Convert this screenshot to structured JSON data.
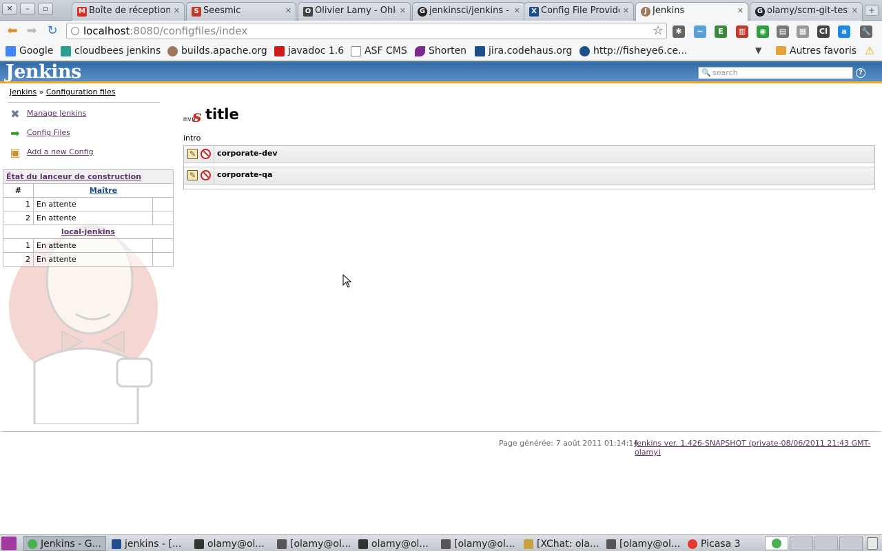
{
  "browser": {
    "tabs": [
      {
        "label": "Boîte de réception",
        "icon": "gmail-icon",
        "color": "#d93025",
        "glyph": "M"
      },
      {
        "label": "Seesmic",
        "icon": "seesmic-icon",
        "color": "#c0392b",
        "glyph": "S"
      },
      {
        "label": "Olivier Lamy - Ohlo",
        "icon": "ohloh-icon",
        "color": "#444444",
        "glyph": "O"
      },
      {
        "label": "jenkinsci/jenkins - G",
        "icon": "github-icon",
        "color": "#222222",
        "glyph": "G"
      },
      {
        "label": "Config File Provider",
        "icon": "confluence-icon",
        "color": "#1f4e8c",
        "glyph": "X"
      },
      {
        "label": "Jenkins",
        "icon": "jenkins-icon",
        "color": "#a0765a",
        "glyph": "J"
      },
      {
        "label": "olamy/scm-git-test",
        "icon": "github-icon",
        "color": "#222222",
        "glyph": "G"
      }
    ],
    "url_host": "localhost",
    "url_path": ":8080/configfiles/index",
    "bookmarks": [
      {
        "label": "Google",
        "icon": "google-icon",
        "color": "#4285f4"
      },
      {
        "label": "cloudbees jenkins",
        "icon": "cloudbees-icon",
        "color": "#2a9d8f"
      },
      {
        "label": "builds.apache.org",
        "icon": "jenkins-icon",
        "color": "#a0765a"
      },
      {
        "label": "javadoc 1.6",
        "icon": "oracle-icon",
        "color": "#d01c1c"
      },
      {
        "label": "ASF CMS",
        "icon": "page-icon",
        "color": "#dddddd"
      },
      {
        "label": "Shorten",
        "icon": "feather-icon",
        "color": "#7b2d8e"
      },
      {
        "label": "jira.codehaus.org",
        "icon": "jira-icon",
        "color": "#1f4e8c"
      },
      {
        "label": "http://fisheye6.ce...",
        "icon": "fisheye-icon",
        "color": "#1f4e8c"
      }
    ],
    "other_bookmarks": "Autres favoris"
  },
  "jenkins": {
    "logo": "Jenkins",
    "search_placeholder": "search",
    "help": "?",
    "breadcrumb": {
      "home": "Jenkins",
      "sep": "»",
      "current": "Configuration files"
    },
    "tasks": [
      {
        "label": "Manage Jenkins",
        "icon": "wrench-screwdriver-icon"
      },
      {
        "label": "Config Files",
        "icon": "green-arrow-icon"
      },
      {
        "label": "Add a new Config",
        "icon": "package-box-icon"
      }
    ],
    "executors": {
      "caption": "État du lanceur de construction",
      "hash_header": "#",
      "master_label": "Maître",
      "master_rows": [
        {
          "num": "1",
          "status": "En attente"
        },
        {
          "num": "2",
          "status": "En attente"
        }
      ],
      "node_label": "local-jenkins",
      "node_rows": [
        {
          "num": "1",
          "status": "En attente"
        },
        {
          "num": "2",
          "status": "En attente"
        }
      ]
    },
    "main": {
      "logo_text": "mvn",
      "logo_glyph": "s",
      "title": "title",
      "intro": "intro",
      "configs": [
        {
          "name": "corporate-dev"
        },
        {
          "name": "corporate-qa"
        }
      ]
    },
    "footer": {
      "generated": "Page générée: 7 août 2011 01:14:14",
      "version": "Jenkins ver. 1.426-SNAPSHOT (private-08/06/2011 21:43 GMT-olamy)"
    },
    "colors": {
      "header": "#2e6aa8",
      "accent": "#f5a623",
      "link": "#5c3566"
    }
  },
  "taskbar": {
    "items": [
      {
        "label": "Jenkins - G...",
        "icon": "chrome-icon",
        "color": "#4caf50",
        "active": true
      },
      {
        "label": "jenkins - [...",
        "icon": "intellij-icon",
        "color": "#1f4e8c",
        "active": false
      },
      {
        "label": "olamy@ol...",
        "icon": "terminal-icon",
        "color": "#333333",
        "active": false
      },
      {
        "label": "[olamy@ol...",
        "icon": "terminal-icon",
        "color": "#555555",
        "active": false
      },
      {
        "label": "olamy@ol...",
        "icon": "terminal-icon",
        "color": "#333333",
        "active": false
      },
      {
        "label": "[olamy@ol...",
        "icon": "terminal-icon",
        "color": "#555555",
        "active": false
      },
      {
        "label": "[XChat: ola...",
        "icon": "xchat-icon",
        "color": "#c8a040",
        "active": false
      },
      {
        "label": "[olamy@ol...",
        "icon": "terminal-icon",
        "color": "#555555",
        "active": false
      },
      {
        "label": "Picasa 3",
        "icon": "picasa-icon",
        "color": "#e53935",
        "active": false
      }
    ]
  }
}
